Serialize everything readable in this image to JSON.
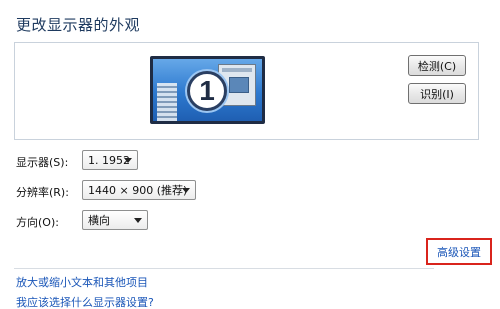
{
  "window": {
    "title": "更改显示器的外观"
  },
  "preview": {
    "monitor_number": "1"
  },
  "buttons": {
    "detect": "检测(C)",
    "identify": "识别(I)"
  },
  "fields": {
    "display": {
      "label": "显示器(S):",
      "value": "1. 1952"
    },
    "resolution": {
      "label": "分辨率(R):",
      "value": "1440 × 900 (推荐)"
    },
    "orientation": {
      "label": "方向(O):",
      "value": "横向"
    }
  },
  "links": {
    "advanced": "高级设置",
    "text_size": "放大或缩小文本和其他项目",
    "which_settings": "我应该选择什么显示器设置?"
  },
  "colors": {
    "highlight_box": "#d9241c",
    "link": "#1a56b8",
    "title": "#1e3a5f"
  }
}
